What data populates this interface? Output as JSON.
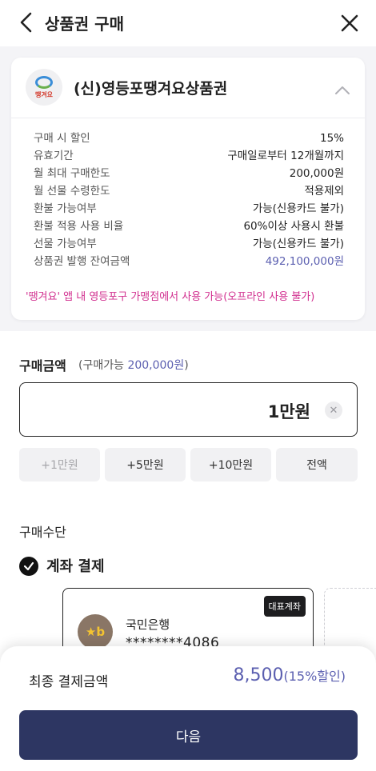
{
  "header": {
    "title": "상품권 구매",
    "back_icon": "chevron-left-icon",
    "close_icon": "close-icon"
  },
  "voucher": {
    "logo_text": "땡겨요",
    "name": "(신)영등포땡겨요상품권",
    "collapse_icon": "chevron-up-icon",
    "info": [
      {
        "label": "구매 시 할인",
        "value": "15%"
      },
      {
        "label": "유효기간",
        "value": "구매일로부터 12개월까지"
      },
      {
        "label": "월 최대 구매한도",
        "value": "200,000원"
      },
      {
        "label": "월 선물 수령한도",
        "value": "적용제외"
      },
      {
        "label": "환불 가능여부",
        "value": "가능(신용카드 불가)"
      },
      {
        "label": "환불 적용 사용 비율",
        "value": "60%이상 사용시 환불"
      },
      {
        "label": "선물 가능여부",
        "value": "가능(신용카드 불가)"
      },
      {
        "label": "상품권 발행 잔여금액",
        "value": "492,100,000원"
      }
    ],
    "notice": "'땡겨요' 앱 내 영등포구 가맹점에서 사용 가능(오프라인 사용 불가)"
  },
  "purchase": {
    "title": "구매금액",
    "limit_prefix": "(구매가능 ",
    "limit_value": "200,000원",
    "limit_suffix": ")",
    "amount": "1만원",
    "clear_icon": "clear-icon",
    "quick_buttons": [
      "+1만원",
      "+5만원",
      "+10만원",
      "전액"
    ]
  },
  "method": {
    "title": "구매수단",
    "selected_label": "계좌 결제",
    "check_icon": "check-icon",
    "account": {
      "badge": "대표계좌",
      "bank_name": "국민은행",
      "bank_logo_text": "★b",
      "number": "********4086"
    }
  },
  "summary": {
    "final_label": "최종 결제금액",
    "final_amount": "8,500",
    "discount": "(15%할인)",
    "next_label": "다음"
  },
  "colors": {
    "accent": "#5b5fb0",
    "primary_button": "#2d3662",
    "notice": "#d12f8f"
  }
}
